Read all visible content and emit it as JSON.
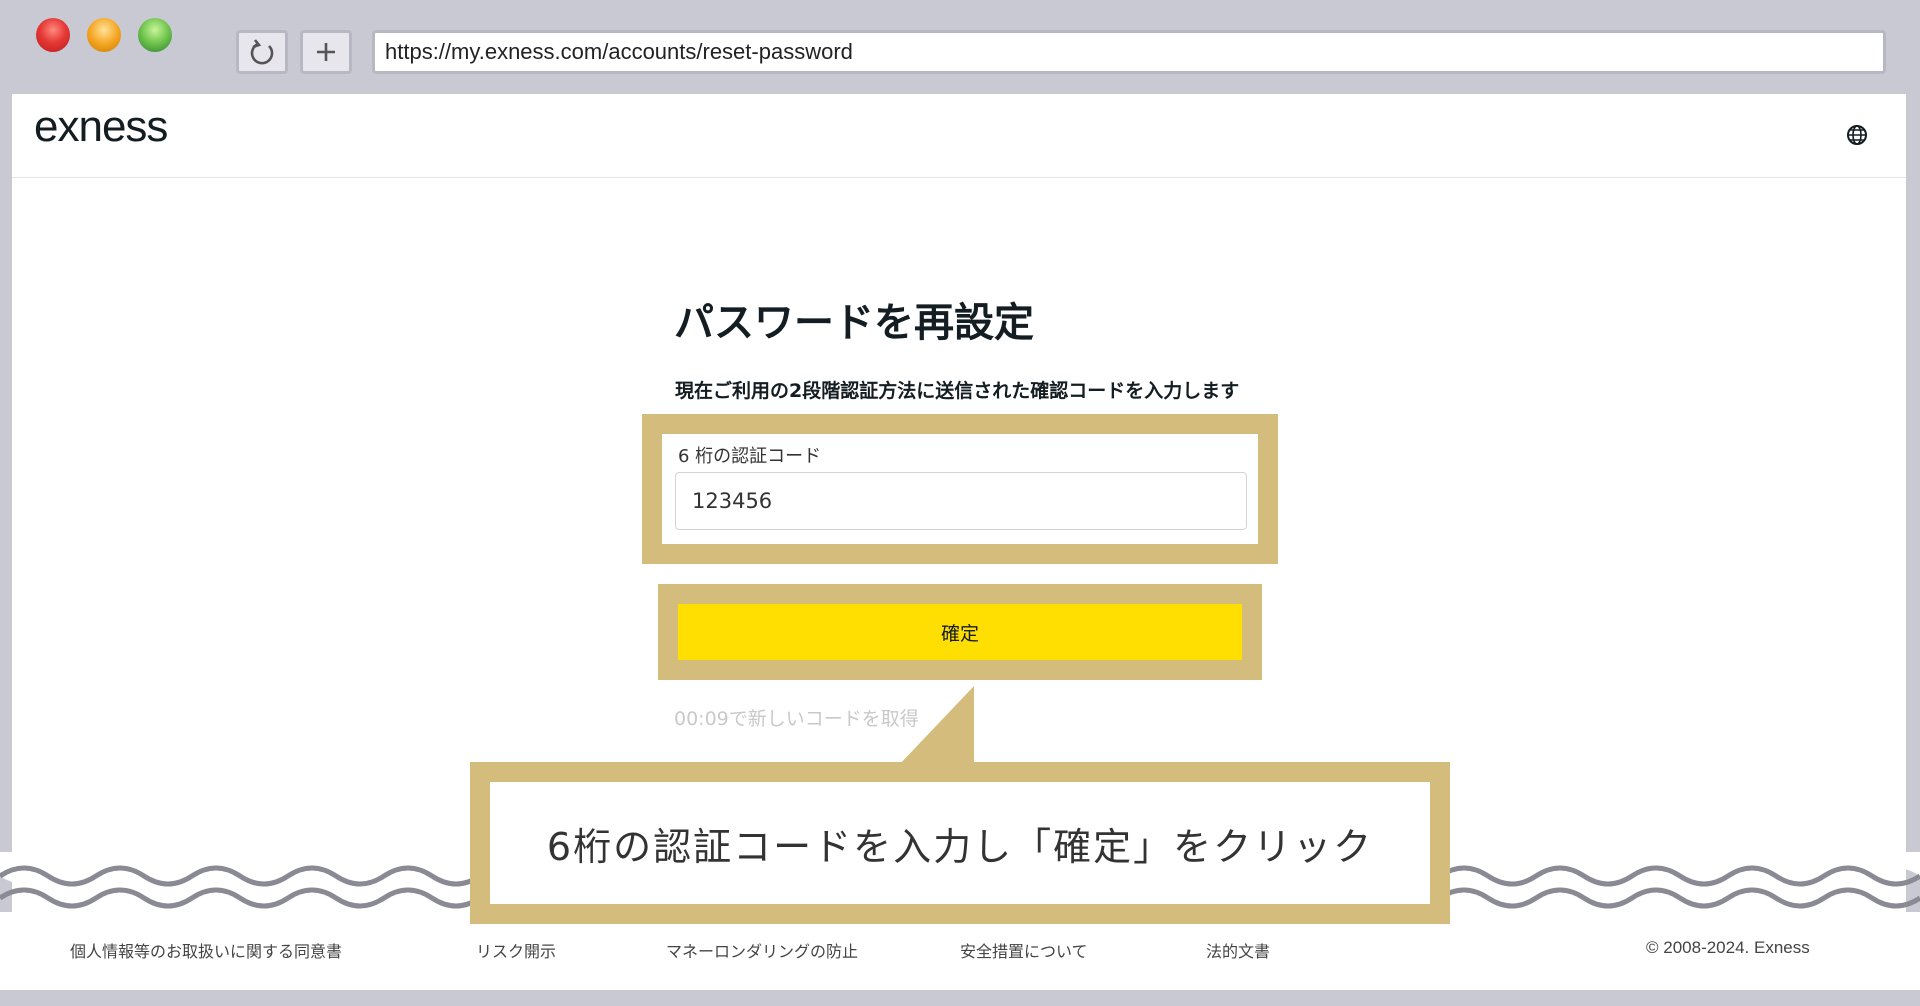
{
  "browser": {
    "url": "https://my.exness.com/accounts/reset-password",
    "reload_icon": "reload-icon",
    "new_tab_icon": "plus-icon"
  },
  "header": {
    "logo": "exness",
    "globe_icon": "globe-icon"
  },
  "main": {
    "title": "パスワードを再設定",
    "subtitle": "現在ご利用の2段階認証方法に送信された確認コードを入力します",
    "code_label": "6 桁の認証コード",
    "code_value": "123456",
    "confirm_label": "確定",
    "resend_text": "00:09で新しいコードを取得"
  },
  "callout": {
    "text": "6桁の認証コードを入力し「確定」をクリック"
  },
  "footer": {
    "links": [
      "個人情報等のお取扱いに関する同意書",
      "リスク開示",
      "マネーロンダリングの防止",
      "安全措置について",
      "法的文書"
    ],
    "copyright": "© 2008-2024. Exness"
  },
  "colors": {
    "accent": "#ffde02",
    "highlight": "#d4bd7c"
  }
}
